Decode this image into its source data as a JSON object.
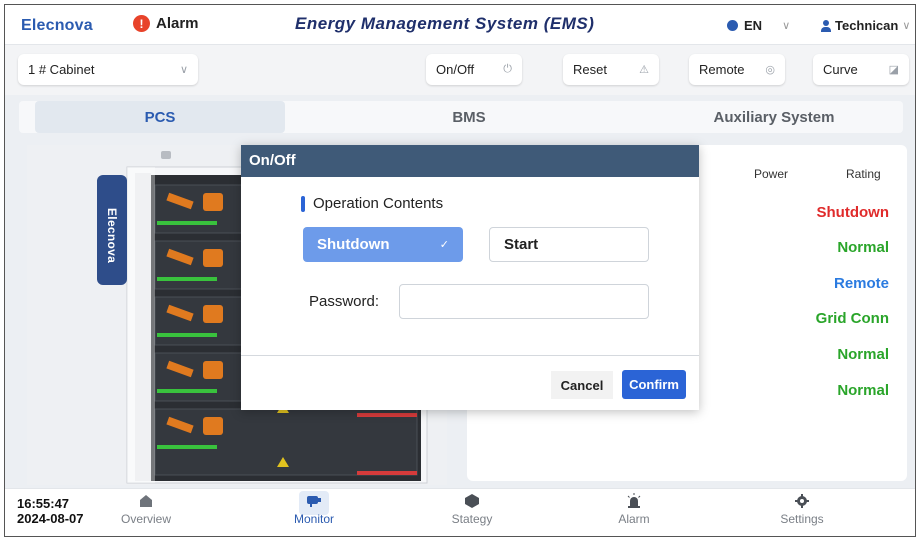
{
  "header": {
    "brand": "Elecnova",
    "alarm_label": "Alarm",
    "title": "Energy Management System (EMS)",
    "language": "EN",
    "user": "Technican"
  },
  "toolbar": {
    "cabinet_select": "1 # Cabinet",
    "onoff_label": "On/Off",
    "reset_label": "Reset",
    "remote_label": "Remote",
    "curve_label": "Curve"
  },
  "tabs": [
    {
      "label": "PCS",
      "active": true
    },
    {
      "label": "BMS",
      "active": false
    },
    {
      "label": "Auxiliary System",
      "active": false
    }
  ],
  "cabinet_brand_text": "Elecnova",
  "status_panel": {
    "headers": [
      "Power",
      "Rating"
    ],
    "values": [
      {
        "text": "Shutdown",
        "color": "#e02b2b"
      },
      {
        "text": "Normal",
        "color": "#2aa52a"
      },
      {
        "text": "Remote",
        "color": "#2b7be0"
      },
      {
        "text": "Grid Conn",
        "color": "#2aa52a"
      },
      {
        "text": "Normal",
        "color": "#2aa52a"
      },
      {
        "text": "Normal",
        "color": "#2aa52a"
      }
    ]
  },
  "modal": {
    "title": "On/Off",
    "section_title": "Operation Contents",
    "option_selected": "Shutdown",
    "option_other": "Start",
    "password_label": "Password:",
    "password_value": "",
    "cancel_label": "Cancel",
    "confirm_label": "Confirm"
  },
  "footer": {
    "time": "16:55:47",
    "date": "2024-08-07",
    "nav": [
      {
        "label": "Overview",
        "icon": "home-icon",
        "active": false
      },
      {
        "label": "Monitor",
        "icon": "monitor-icon",
        "active": true
      },
      {
        "label": "Stategy",
        "icon": "strategy-icon",
        "active": false
      },
      {
        "label": "Alarm",
        "icon": "alarm-light-icon",
        "active": false
      },
      {
        "label": "Settings",
        "icon": "gear-icon",
        "active": false
      }
    ]
  }
}
